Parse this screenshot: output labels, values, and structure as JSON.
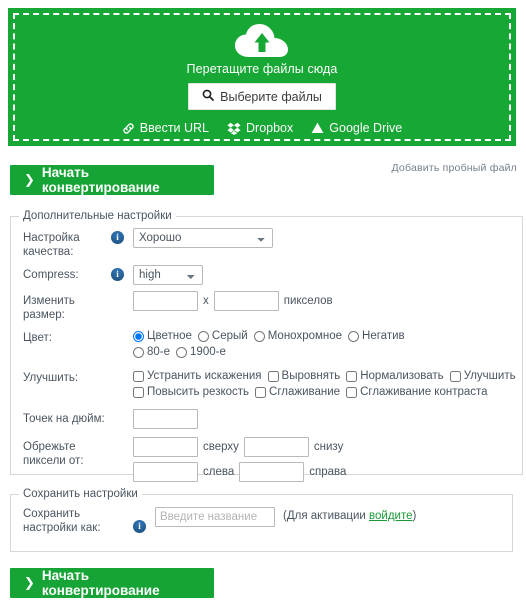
{
  "theme": {
    "green": "#16a734",
    "button_green": "#15a435",
    "info_blue": "#2c6fad",
    "link_green": "#1a9a35",
    "text": "#4a5560"
  },
  "dropzone": {
    "icon": "cloud-upload-icon",
    "drop_text": "Перетащите файлы сюда",
    "choose_button": "Выберите файлы",
    "choose_button_icon": "search-icon",
    "providers": [
      {
        "label": "Ввести URL",
        "icon": "link-icon"
      },
      {
        "label": "Dropbox",
        "icon": "dropbox-icon"
      },
      {
        "label": "Google Drive",
        "icon": "google-drive-icon"
      }
    ]
  },
  "actions": {
    "start_conversion_top": "Начать конвертирование",
    "start_conversion_bottom": "Начать конвертирование",
    "chevron": "❯",
    "trial_file_link": "Добавить пробный файл"
  },
  "advanced": {
    "legend": "Дополнительные настройки",
    "quality": {
      "label": "Настройка качества:",
      "info_icon": "info-icon",
      "selected": "Хорошо",
      "options": [
        "Хорошо"
      ]
    },
    "compress": {
      "label": "Compress:",
      "info_icon": "info-icon",
      "selected": "high",
      "options": [
        "high"
      ]
    },
    "resize": {
      "label": "Изменить размер:",
      "width_value": "",
      "height_value": "",
      "separator": "x",
      "unit": "пикселов"
    },
    "color": {
      "label": "Цвет:",
      "selected": "Цветное",
      "options": [
        "Цветное",
        "Серый",
        "Монохромное",
        "Негатив",
        "80-е",
        "1900-е"
      ]
    },
    "enhance": {
      "label": "Улучшить:",
      "options": [
        {
          "label": "Устранить искажения",
          "checked": false
        },
        {
          "label": "Выровнять",
          "checked": false
        },
        {
          "label": "Нормализовать",
          "checked": false
        },
        {
          "label": "Улучшить",
          "checked": false
        },
        {
          "label": "Повысить резкость",
          "checked": false
        },
        {
          "label": "Сглаживание",
          "checked": false
        },
        {
          "label": "Сглаживание контраста",
          "checked": false
        }
      ]
    },
    "dpi": {
      "label": "Точек на дюйм:",
      "value": ""
    },
    "crop": {
      "label": "Обрежьте пиксели от:",
      "top_value": "",
      "top_unit": "сверху",
      "bottom_value": "",
      "bottom_unit": "снизу",
      "left_value": "",
      "left_unit": "слева",
      "right_value": "",
      "right_unit": "справа"
    }
  },
  "save_settings": {
    "legend": "Сохранить настройки",
    "label": "Сохранить настройки как:",
    "info_icon": "info-icon",
    "input_placeholder": "Введите название",
    "input_value": "",
    "note_prefix": "(Для активации ",
    "note_link": "войдите",
    "note_suffix": ")"
  }
}
